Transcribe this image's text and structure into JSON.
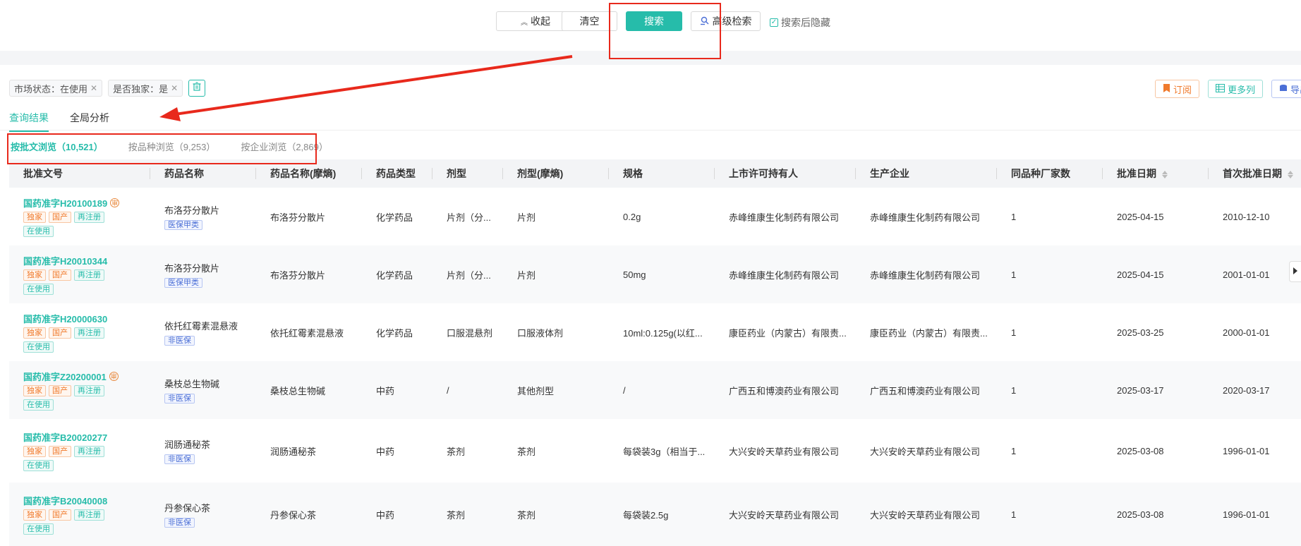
{
  "toolbar": {
    "collapse_label": "收起",
    "clear_label": "清空",
    "search_label": "搜索",
    "advanced_label": "高级检索",
    "hide_after_search_label": "搜索后隐藏"
  },
  "filters": [
    {
      "label": "市场状态：在使用"
    },
    {
      "label": "是否独家：是"
    }
  ],
  "right_actions": {
    "subscribe_label": "订阅",
    "more_columns_label": "更多列",
    "export_label": "导出"
  },
  "tabs": [
    {
      "label": "查询结果"
    },
    {
      "label": "全局分析"
    }
  ],
  "subtabs": [
    {
      "label": "按批文浏览（10,521）"
    },
    {
      "label": "按品种浏览（9,253）"
    },
    {
      "label": "按企业浏览（2,869）"
    }
  ],
  "columns": [
    "批准文号",
    "药品名称",
    "药品名称(摩熵)",
    "药品类型",
    "剂型",
    "剂型(摩熵)",
    "规格",
    "上市许可持有人",
    "生产企业",
    "同品种厂家数",
    "批准日期",
    "首次批准日期"
  ],
  "rows": [
    {
      "approval": "国药准字H20100189",
      "has_badge": true,
      "tags": [
        "独家",
        "国产",
        "再注册",
        "在使用"
      ],
      "name": "布洛芬分散片",
      "ins": "医保甲类",
      "name2": "布洛芬分散片",
      "type": "化学药品",
      "form": "片剂（分...",
      "form2": "片剂",
      "spec": "0.2g",
      "holder": "赤峰维康生化制药有限公司",
      "maker": "赤峰维康生化制药有限公司",
      "count": "1",
      "date": "2025-04-15",
      "first": "2010-12-10"
    },
    {
      "approval": "国药准字H20010344",
      "has_badge": false,
      "tags": [
        "独家",
        "国产",
        "再注册",
        "在使用"
      ],
      "name": "布洛芬分散片",
      "ins": "医保甲类",
      "name2": "布洛芬分散片",
      "type": "化学药品",
      "form": "片剂（分...",
      "form2": "片剂",
      "spec": "50mg",
      "holder": "赤峰维康生化制药有限公司",
      "maker": "赤峰维康生化制药有限公司",
      "count": "1",
      "date": "2025-04-15",
      "first": "2001-01-01"
    },
    {
      "approval": "国药准字H20000630",
      "has_badge": false,
      "tags": [
        "独家",
        "国产",
        "再注册",
        "在使用"
      ],
      "name": "依托红霉素混悬液",
      "ins": "非医保",
      "name2": "依托红霉素混悬液",
      "type": "化学药品",
      "form": "口服混悬剂",
      "form2": "口服液体剂",
      "spec": "10ml:0.125g(以红...",
      "holder": "康臣药业（内蒙古）有限责...",
      "maker": "康臣药业（内蒙古）有限责...",
      "count": "1",
      "date": "2025-03-25",
      "first": "2000-01-01"
    },
    {
      "approval": "国药准字Z20200001",
      "has_badge": true,
      "tags": [
        "独家",
        "国产",
        "再注册",
        "在使用"
      ],
      "name": "桑枝总生物碱",
      "ins": "非医保",
      "name2": "桑枝总生物碱",
      "type": "中药",
      "form": "/",
      "form2": "其他剂型",
      "spec": "/",
      "holder": "广西五和博澳药业有限公司",
      "maker": "广西五和博澳药业有限公司",
      "count": "1",
      "date": "2025-03-17",
      "first": "2020-03-17"
    },
    {
      "approval": "国药准字B20020277",
      "has_badge": false,
      "tags": [
        "独家",
        "国产",
        "再注册",
        "在使用"
      ],
      "name": "润肠通秘茶",
      "ins": "非医保",
      "name2": "润肠通秘茶",
      "type": "中药",
      "form": "茶剂",
      "form2": "茶剂",
      "spec": "每袋装3g（相当于...",
      "holder": "大兴安岭天草药业有限公司",
      "maker": "大兴安岭天草药业有限公司",
      "count": "1",
      "date": "2025-03-08",
      "first": "1996-01-01"
    },
    {
      "approval": "国药准字B20040008",
      "has_badge": false,
      "tags": [
        "独家",
        "国产",
        "再注册",
        "在使用"
      ],
      "name": "丹参保心茶",
      "ins": "非医保",
      "name2": "丹参保心茶",
      "type": "中药",
      "form": "茶剂",
      "form2": "茶剂",
      "spec": "每袋装2.5g",
      "holder": "大兴安岭天草药业有限公司",
      "maker": "大兴安岭天草药业有限公司",
      "count": "1",
      "date": "2025-03-08",
      "first": "1996-01-01"
    }
  ],
  "approval_badge_text": "审",
  "colors": {
    "accent": "#26bcaa",
    "annotation": "#e8291c",
    "orange": "#f07a2c"
  }
}
